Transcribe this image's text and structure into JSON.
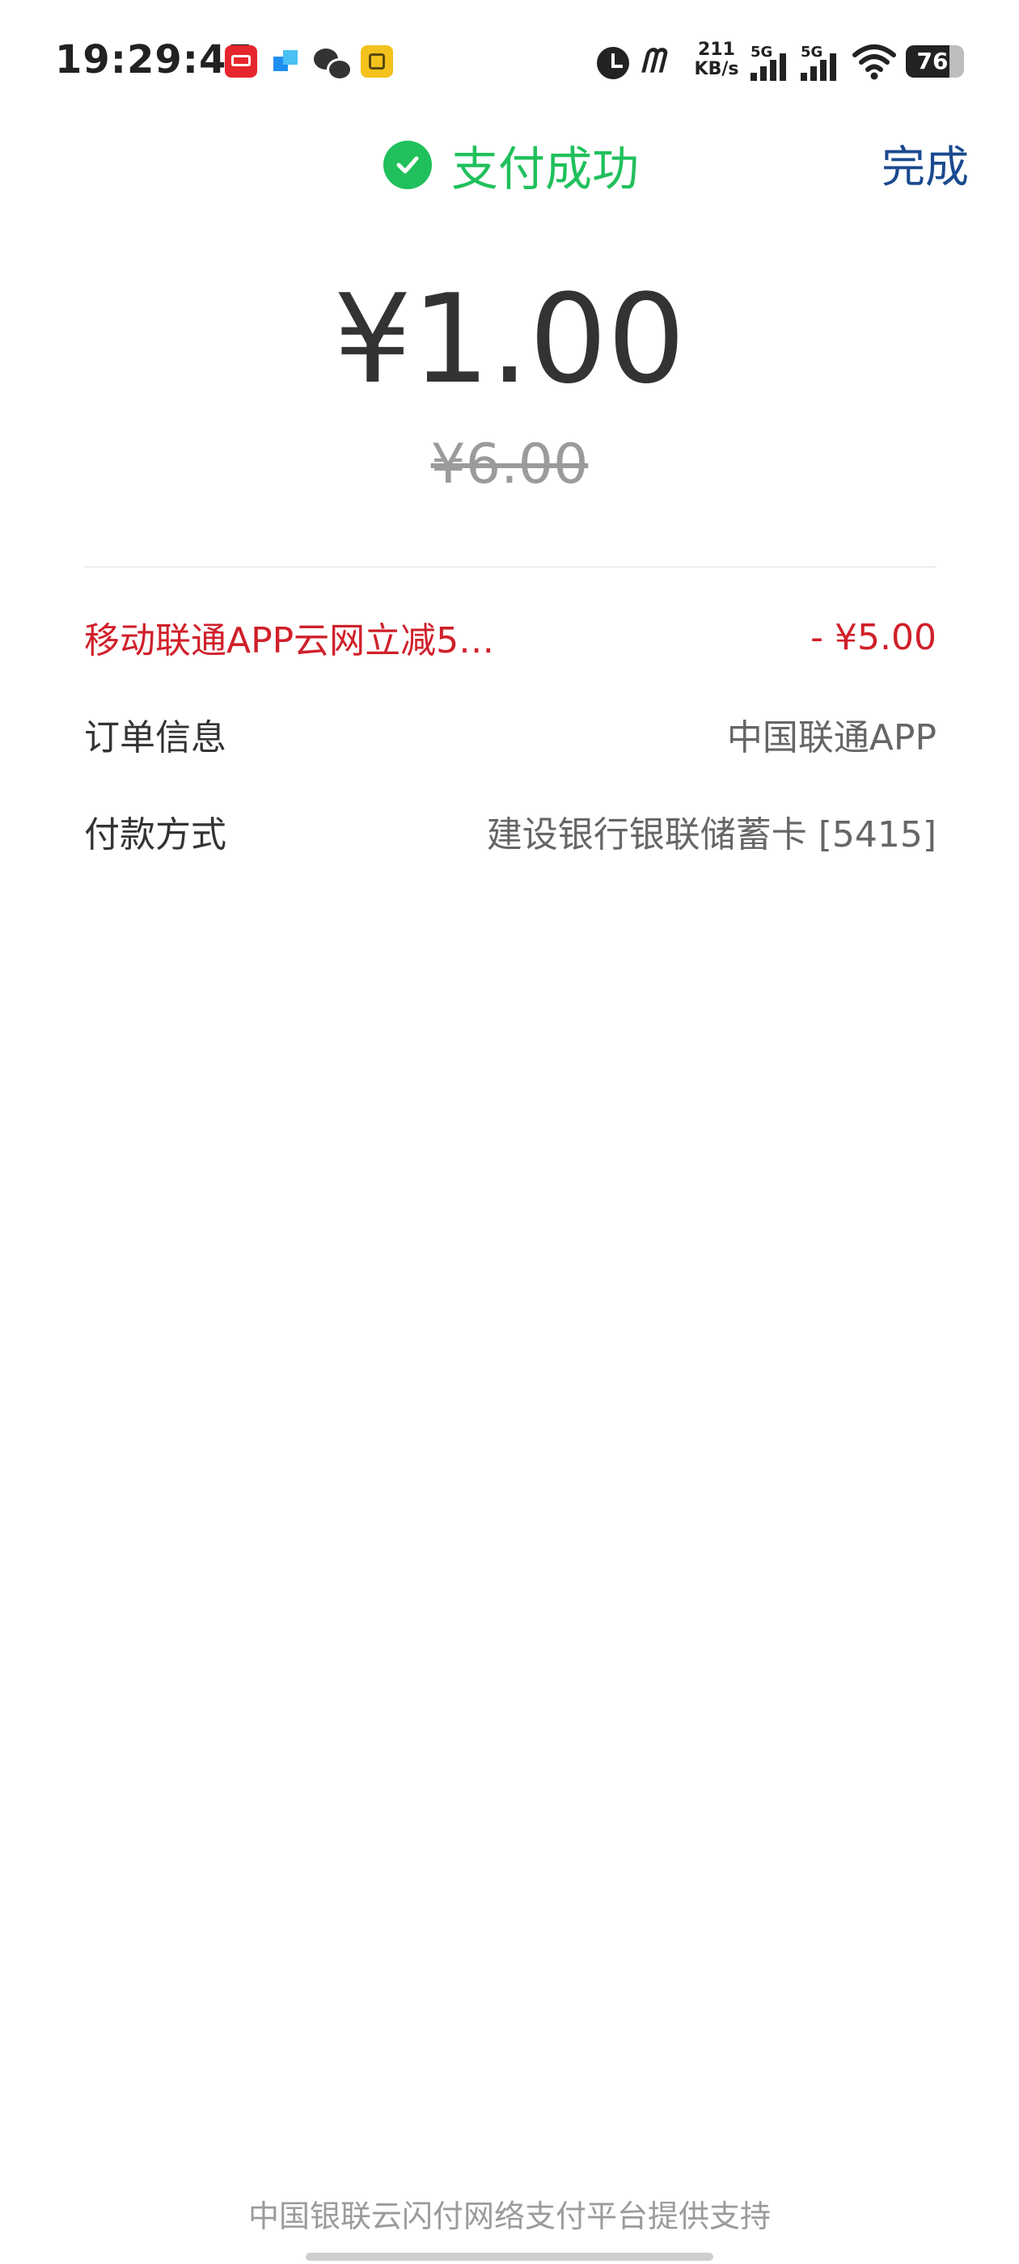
{
  "status_bar": {
    "time": "19:29:45",
    "net_speed_value": "211",
    "net_speed_unit": "KB/s",
    "signal_1_label": "5G",
    "signal_2_label": "5G",
    "battery": "76",
    "icons": [
      "unionpay-icon",
      "app-icon",
      "wechat-icon",
      "notes-icon",
      "alarm-icon",
      "m-icon",
      "signal-icon",
      "wifi-icon",
      "battery-icon"
    ]
  },
  "header": {
    "title": "支付成功",
    "done_label": "完成",
    "accent_color": "#20c05c",
    "link_color": "#1a4a8f"
  },
  "payment": {
    "amount": "¥1.00",
    "original_amount": "¥6.00"
  },
  "details": [
    {
      "label": "移动联通APP云网立减5…",
      "value": "- ¥5.00",
      "color": "#d0202a"
    },
    {
      "label": "订单信息",
      "value": "中国联通APP"
    },
    {
      "label": "付款方式",
      "value": "建设银行银联储蓄卡 [5415]"
    }
  ],
  "footer": {
    "text": "中国银联云闪付网络支付平台提供支持"
  }
}
